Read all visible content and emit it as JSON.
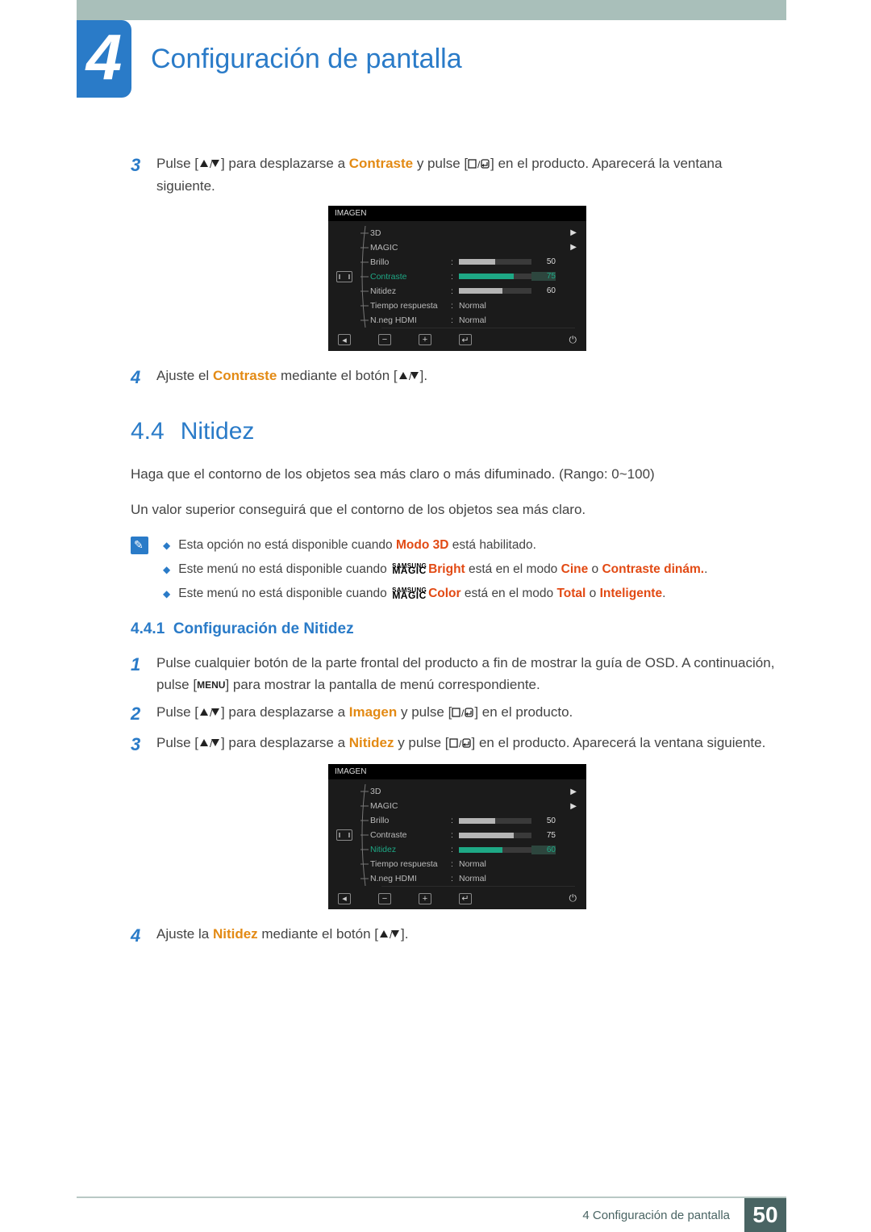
{
  "chapter": {
    "number": "4",
    "title": "Configuración de pantalla"
  },
  "step3a": {
    "num": "3",
    "pre": "Pulse [",
    "mid1": "] para desplazarse a ",
    "hl": "Contraste",
    "mid2": " y pulse [",
    "post": "] en el producto. Aparecerá la ventana siguiente."
  },
  "step4a": {
    "num": "4",
    "pre": "Ajuste el ",
    "hl": "Contraste",
    "mid": " mediante el botón [",
    "post": "]."
  },
  "osd1": {
    "title": "IMAGEN",
    "rows": [
      {
        "label": "3D",
        "type": "arrow"
      },
      {
        "label": "MAGIC",
        "type": "arrow"
      },
      {
        "label": "Brillo",
        "type": "bar",
        "value": 50,
        "pct": 50,
        "sel": false
      },
      {
        "label": "Contraste",
        "type": "bar",
        "value": 75,
        "pct": 75,
        "sel": true
      },
      {
        "label": "Nitidez",
        "type": "bar",
        "value": 60,
        "pct": 60,
        "sel": false
      },
      {
        "label": "Tiempo respuesta",
        "type": "text",
        "value": "Normal"
      },
      {
        "label": "N.neg HDMI",
        "type": "text",
        "value": "Normal"
      }
    ]
  },
  "sec44": {
    "num": "4.4",
    "title": "Nitidez"
  },
  "para1": "Haga que el contorno de los objetos sea más claro o más difuminado. (Rango: 0~100)",
  "para2": "Un valor superior conseguirá que el contorno de los objetos sea más claro.",
  "notes": [
    {
      "plain1": "Esta opción no está disponible cuando ",
      "hl1": "Modo 3D",
      "plain2": " está habilitado."
    },
    {
      "plain1": "Este menú no está disponible cuando ",
      "magic": true,
      "mlabel": "Bright",
      "plain2": " está en el modo ",
      "hl1": "Cine",
      "plain3": " o ",
      "hl2": "Contraste dinám.",
      "plain4": "."
    },
    {
      "plain1": "Este menú no está disponible cuando ",
      "magic": true,
      "mlabel": "Color",
      "plain2": " está en el modo ",
      "hl1": "Total",
      "plain3": " o ",
      "hl2": "Inteligente",
      "plain4": "."
    }
  ],
  "subsec": {
    "num": "4.4.1",
    "title": "Configuración de Nitidez"
  },
  "s1": {
    "num": "1",
    "t1": "Pulse cualquier botón de la parte frontal del producto a fin de mostrar la guía de OSD. A continuación, pulse [",
    "menu": "MENU",
    "t2": "] para mostrar la pantalla de menú correspondiente."
  },
  "s2": {
    "num": "2",
    "t1": "Pulse [",
    "t2": "] para desplazarse a ",
    "hl": "Imagen",
    "t3": " y pulse [",
    "t4": "] en el producto."
  },
  "s3": {
    "num": "3",
    "t1": "Pulse [",
    "t2": "] para desplazarse a ",
    "hl": "Nitidez",
    "t3": " y pulse [",
    "t4": "] en el producto. Aparecerá la ventana siguiente."
  },
  "osd2": {
    "title": "IMAGEN",
    "rows": [
      {
        "label": "3D",
        "type": "arrow"
      },
      {
        "label": "MAGIC",
        "type": "arrow"
      },
      {
        "label": "Brillo",
        "type": "bar",
        "value": 50,
        "pct": 50,
        "sel": false
      },
      {
        "label": "Contraste",
        "type": "bar",
        "value": 75,
        "pct": 75,
        "sel": false
      },
      {
        "label": "Nitidez",
        "type": "bar",
        "value": 60,
        "pct": 60,
        "sel": true
      },
      {
        "label": "Tiempo respuesta",
        "type": "text",
        "value": "Normal"
      },
      {
        "label": "N.neg HDMI",
        "type": "text",
        "value": "Normal"
      }
    ]
  },
  "s4b": {
    "num": "4",
    "t1": "Ajuste la ",
    "hl": "Nitidez",
    "t2": " mediante el botón [",
    "t3": "]."
  },
  "footer": {
    "chapter": "4 Configuración de pantalla",
    "page": "50"
  },
  "magic_label": {
    "top": "SAMSUNG",
    "bot": "MAGIC"
  }
}
